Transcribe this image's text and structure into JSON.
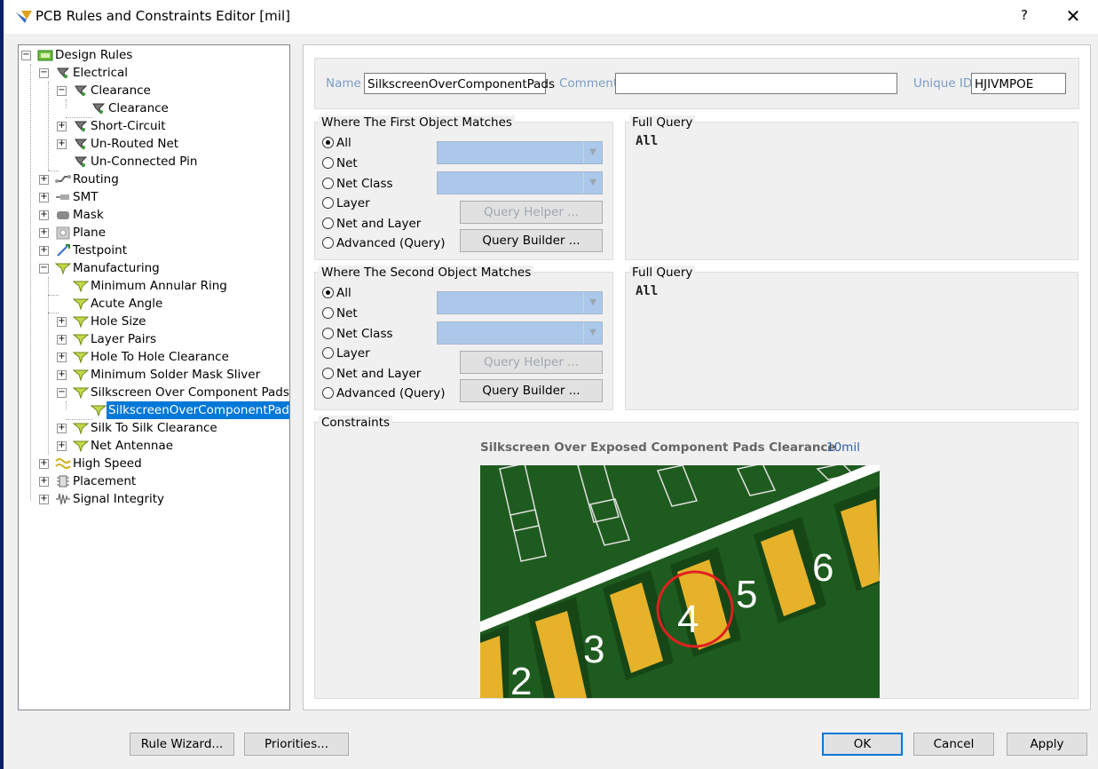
{
  "window": {
    "title": "PCB Rules and Constraints Editor [mil]",
    "help_label": "?",
    "close_label": "✕"
  },
  "tree": {
    "root": "Design Rules",
    "electrical": "Electrical",
    "clearance_group": "Clearance",
    "clearance_rule": "Clearance",
    "short_circuit": "Short-Circuit",
    "unrouted_net": "Un-Routed Net",
    "unconnected_pin": "Un-Connected Pin",
    "routing": "Routing",
    "smt": "SMT",
    "mask": "Mask",
    "plane": "Plane",
    "testpoint": "Testpoint",
    "manufacturing": "Manufacturing",
    "min_annular_ring": "Minimum Annular Ring",
    "acute_angle": "Acute Angle",
    "hole_size": "Hole Size",
    "layer_pairs": "Layer Pairs",
    "hole_to_hole": "Hole To Hole Clearance",
    "min_solder_mask": "Minimum Solder Mask Sliver",
    "silkscreen_over_pads": "Silkscreen Over Component Pads",
    "silkscreen_rule": "SilkscreenOverComponentPads",
    "silk_to_silk": "Silk To Silk Clearance",
    "net_antennae": "Net Antennae",
    "high_speed": "High Speed",
    "placement": "Placement",
    "signal_integrity": "Signal Integrity"
  },
  "rule": {
    "name_label": "Name",
    "name_value": "SilkscreenOverComponentPads",
    "comment_label": "Comment",
    "comment_value": "",
    "uid_label": "Unique ID",
    "uid_value": "HJIVMPOE"
  },
  "first": {
    "title": "Where The First Object Matches",
    "opt_all": "All",
    "opt_net": "Net",
    "opt_netclass": "Net Class",
    "opt_layer": "Layer",
    "opt_netlayer": "Net and Layer",
    "opt_advanced": "Advanced (Query)",
    "query_helper": "Query Helper ...",
    "query_builder": "Query Builder ...",
    "full_query_title": "Full Query",
    "full_query": "All"
  },
  "second": {
    "title": "Where The Second Object Matches",
    "opt_all": "All",
    "opt_net": "Net",
    "opt_netclass": "Net Class",
    "opt_layer": "Layer",
    "opt_netlayer": "Net and Layer",
    "opt_advanced": "Advanced (Query)",
    "query_helper": "Query Helper ...",
    "query_builder": "Query Builder ...",
    "full_query_title": "Full Query",
    "full_query": "All"
  },
  "constraints": {
    "title": "Constraints",
    "label": "Silkscreen Over Exposed Component Pads Clearance",
    "value": "10mil",
    "pad_numbers": [
      "2",
      "3",
      "4",
      "5",
      "6"
    ]
  },
  "buttons": {
    "rule_wizard": "Rule Wizard...",
    "priorities": "Priorities...",
    "ok": "OK",
    "cancel": "Cancel",
    "apply": "Apply"
  },
  "colors": {
    "selection": "#0078d7",
    "pcb_green": "#1e5b1e",
    "pad_yellow": "#e5b22a",
    "highlight_red": "#e02020"
  }
}
